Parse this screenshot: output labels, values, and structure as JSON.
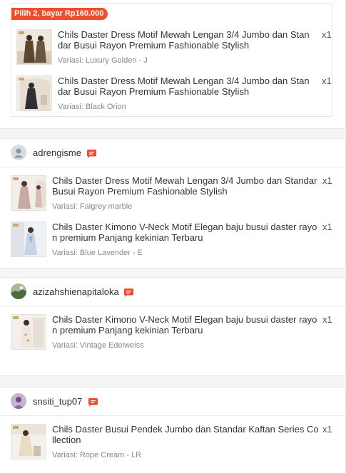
{
  "colors": {
    "accent": "#ee4d2d",
    "page_bg": "#f5f5f5",
    "card_bg": "#ffffff"
  },
  "promo": {
    "badge": "Pilih 2, bayar Rp160.000",
    "items": [
      {
        "title": "Chils Daster Dress Motif Mewah Lengan 3/4 Jumbo dan Standar Busui Rayon Premium Fashionable Stylish",
        "qty": "x1",
        "variant": "Variasi: Luxury Golden - J"
      },
      {
        "title": "Chils Daster Dress Motif Mewah Lengan 3/4 Jumbo dan Standar Busui Rayon Premium Fashionable Stylish",
        "qty": "x1",
        "variant": "Variasi: Black Orion"
      }
    ]
  },
  "shops": [
    {
      "seller": "adrengisme",
      "avatar_icon": "default-user-icon",
      "chat_icon": "chat-icon",
      "items": [
        {
          "title": "Chils Daster Dress Motif Mewah Lengan 3/4 Jumbo dan Standar Busui Rayon Premium Fashionable Stylish",
          "qty": "x1",
          "variant": "Variasi: Falgrey marble"
        },
        {
          "title": "Chils Daster Kimono V-Neck Motif Elegan baju busui daster rayon premium Panjang kekinian Terbaru",
          "qty": "x1",
          "variant": "Variasi: Blue Lavender - E"
        }
      ]
    },
    {
      "seller": "azizahshienapitaloka",
      "avatar_icon": "profile-photo",
      "chat_icon": "chat-icon",
      "items": [
        {
          "title": "Chils Daster Kimono V-Neck Motif Elegan baju busui daster rayon premium Panjang kekinian Terbaru",
          "qty": "x1",
          "variant": "Variasi: Vintage Edelweiss"
        }
      ]
    },
    {
      "seller": "snsiti_tup07",
      "avatar_icon": "profile-photo",
      "chat_icon": "chat-icon",
      "items": [
        {
          "title": "Chils Daster Busui Pendek Jumbo dan Standar Kaftan Series Collection",
          "qty": "x1",
          "variant": "Variasi: Rope Cream - LR"
        }
      ]
    }
  ]
}
